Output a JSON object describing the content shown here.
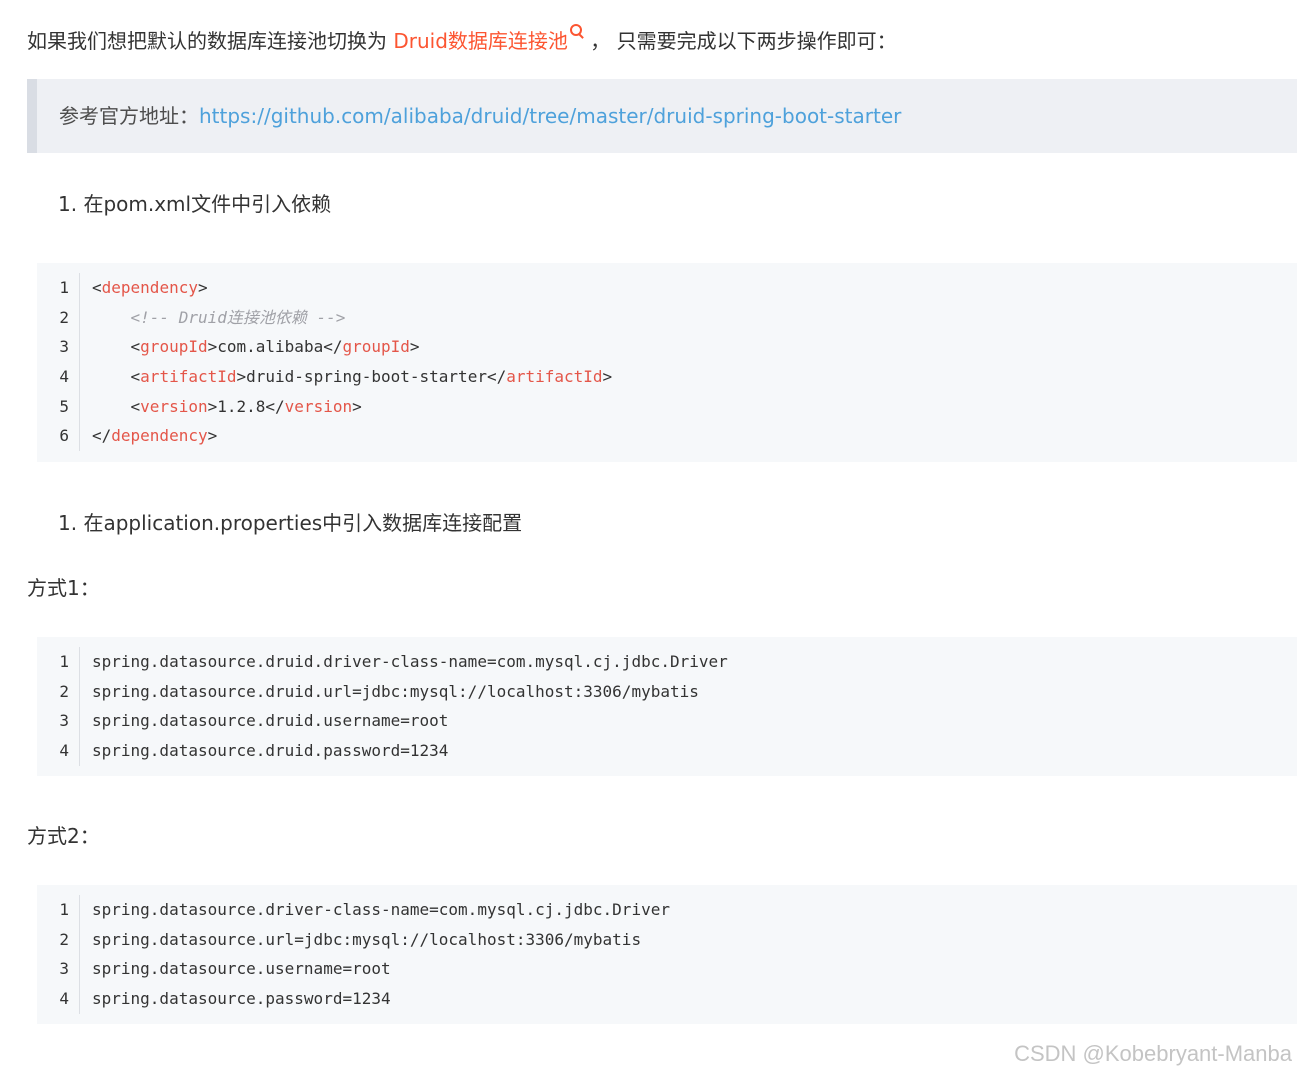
{
  "intro": {
    "before": "如果我们想把默认的数据库连接池切换为 ",
    "keyword": "Druid数据库连接池",
    "after": " ，  只需要完成以下两步操作即可："
  },
  "quote": {
    "label": "参考官方地址：",
    "link": "https://github.com/alibaba/druid/tree/master/druid-spring-boot-starter"
  },
  "step1": "1. 在pom.xml文件中引入依赖",
  "code1": {
    "line_numbers": [
      "1",
      "2",
      "3",
      "4",
      "5",
      "6"
    ],
    "lines": {
      "l1": {
        "open": "<",
        "tag": "dependency",
        "close": ">"
      },
      "l2": {
        "comment": "    <!-- Druid连接池依赖 -->"
      },
      "l3": {
        "indent": "    ",
        "open": "<",
        "tag": "groupId",
        "mid": ">com.alibaba</",
        "tag2": "groupId",
        "close": ">"
      },
      "l4": {
        "indent": "    ",
        "open": "<",
        "tag": "artifactId",
        "mid": ">druid-spring-boot-starter</",
        "tag2": "artifactId",
        "close": ">"
      },
      "l5": {
        "indent": "    ",
        "open": "<",
        "tag": "version",
        "mid": ">1.2.8</",
        "tag2": "version",
        "close": ">"
      },
      "l6": {
        "open": "</",
        "tag": "dependency",
        "close": ">"
      }
    }
  },
  "step2": "1. 在application.properties中引入数据库连接配置",
  "method1": "方式1：",
  "code2": {
    "line_numbers": [
      "1",
      "2",
      "3",
      "4"
    ],
    "lines": [
      "spring.datasource.druid.driver-class-name=com.mysql.cj.jdbc.Driver",
      "spring.datasource.druid.url=jdbc:mysql://localhost:3306/mybatis",
      "spring.datasource.druid.username=root",
      "spring.datasource.druid.password=1234"
    ]
  },
  "method2": "方式2：",
  "code3": {
    "line_numbers": [
      "1",
      "2",
      "3",
      "4"
    ],
    "lines": [
      "spring.datasource.driver-class-name=com.mysql.cj.jdbc.Driver",
      "spring.datasource.url=jdbc:mysql://localhost:3306/mybatis",
      "spring.datasource.username=root",
      "spring.datasource.password=1234"
    ]
  },
  "watermark": "CSDN @Kobebryant-Manba",
  "colors": {
    "keyword": "#fc5531",
    "link": "#4ea1db",
    "tag": "#e45649",
    "comment": "#a0a1a7",
    "quote_bg": "#eef0f4",
    "code_bg": "#f6f8fa"
  },
  "icons": {
    "keyword_search": "search-icon"
  }
}
